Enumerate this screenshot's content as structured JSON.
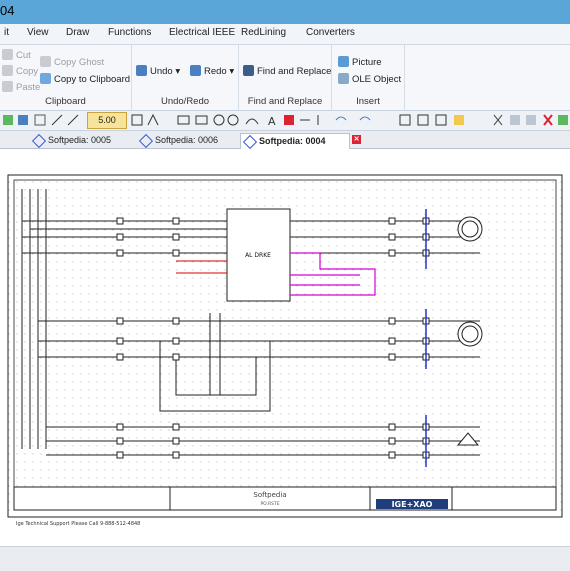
{
  "window": {
    "title": "04"
  },
  "menu": [
    "it",
    "View",
    "Draw",
    "Functions",
    "Electrical IEEE",
    "RedLining",
    "Converters"
  ],
  "ribbon": {
    "clipboard": {
      "cut": "Cut",
      "copy": "Copy",
      "paste": "Paste",
      "copy_ghost": "Copy Ghost",
      "copy_to_clipboard": "Copy to Clipboard",
      "caption": "Clipboard"
    },
    "undoredo": {
      "undo": "Undo",
      "redo": "Redo",
      "caption": "Undo/Redo"
    },
    "find": {
      "find_replace": "Find and Replace",
      "caption": "Find and Replace"
    },
    "insert": {
      "picture": "Picture",
      "ole": "OLE Object",
      "caption": "Insert"
    }
  },
  "toolbar": {
    "zoom": "5.00"
  },
  "tabs": [
    {
      "label": "Softpedia: 0005"
    },
    {
      "label": "Softpedia: 0006"
    },
    {
      "label": "Softpedia: 0004"
    }
  ],
  "drawing": {
    "center_block": "AL DRKE",
    "title_center": "Softpedia",
    "title_center_sub": "PO.RSTE",
    "logo": "IGE+XAO",
    "footer": "Ige Technical Support Please Call 9-888-512-4848"
  },
  "colors": {
    "accent": "#5aa6d8",
    "wire_magenta": "#d400d4",
    "wire_red": "#d40000",
    "wire_blue": "#2233cc"
  }
}
